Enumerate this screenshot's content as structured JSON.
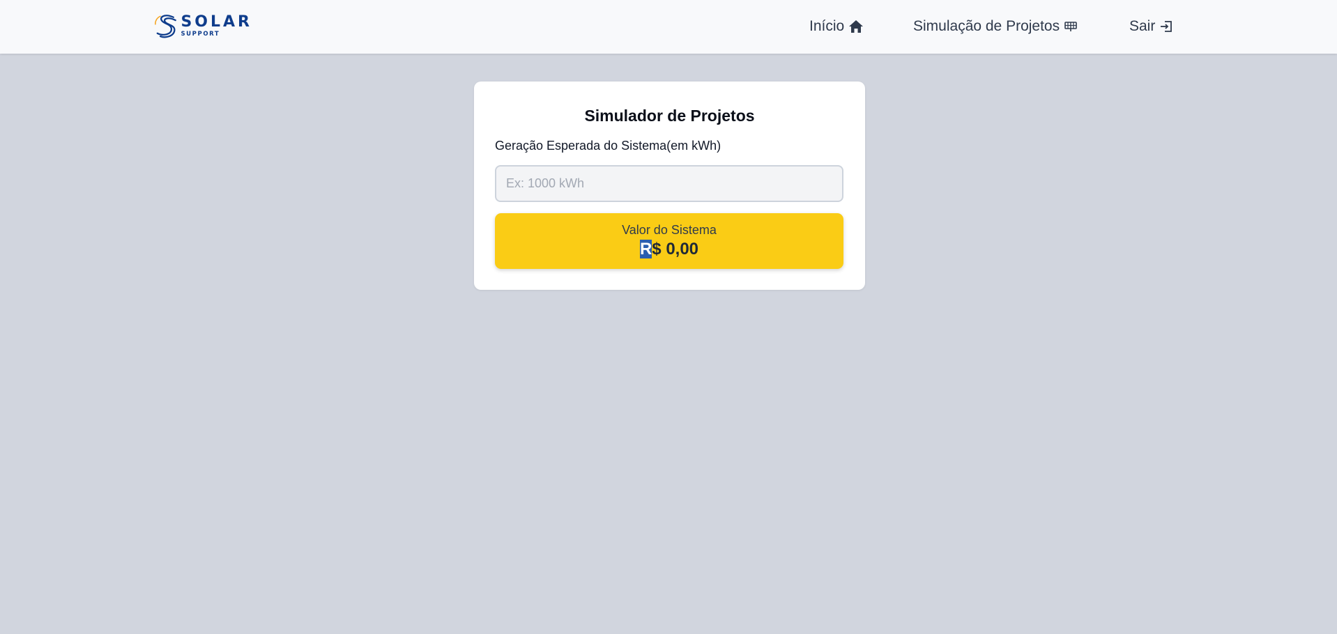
{
  "brand": {
    "name": "SOLAR",
    "tagline": "SUPPORT",
    "colors": {
      "primary": "#0f3d8c",
      "accent": "#f5a623"
    }
  },
  "nav": {
    "items": [
      {
        "label": "Início",
        "icon": "home-icon"
      },
      {
        "label": "Simulação de Projetos",
        "icon": "solar-panel-icon"
      },
      {
        "label": "Sair",
        "icon": "logout-icon"
      }
    ]
  },
  "simulator": {
    "title": "Simulador de Projetos",
    "field_label": "Geração Esperada do Sistema(em kWh)",
    "input_value": "",
    "input_placeholder": "Ex: 1000 kWh",
    "result_label": "Valor do Sistema",
    "result_value_selected": "R",
    "result_value_rest": "$ 0,00",
    "result_color": "#facc15"
  }
}
